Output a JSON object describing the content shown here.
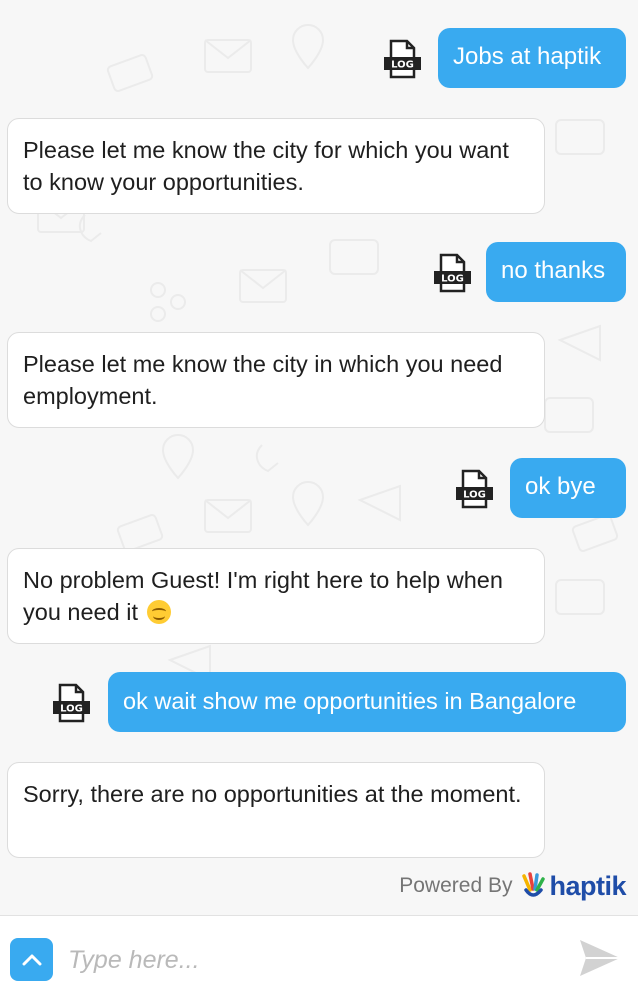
{
  "messages": [
    {
      "sender": "user",
      "text": "Jobs at haptik"
    },
    {
      "sender": "bot",
      "text": "Please let me know the city for which you want to know your opportunities."
    },
    {
      "sender": "user",
      "text": "no thanks"
    },
    {
      "sender": "bot",
      "text": "Please let me know the city in which you need employment."
    },
    {
      "sender": "user",
      "text": "ok bye"
    },
    {
      "sender": "bot",
      "text": "No problem Guest! I'm right here to help when you need it"
    },
    {
      "sender": "user",
      "text": "ok wait show me opportunities in Bangalore"
    },
    {
      "sender": "bot",
      "text": "Sorry, there are no opportunities at the moment."
    }
  ],
  "log_icon_label": "LOG",
  "footer": {
    "powered_by": "Powered By",
    "brand": "haptik"
  },
  "composer": {
    "placeholder": "Type here..."
  },
  "colors": {
    "accent": "#39aaf0",
    "brand": "#1f4da8"
  }
}
